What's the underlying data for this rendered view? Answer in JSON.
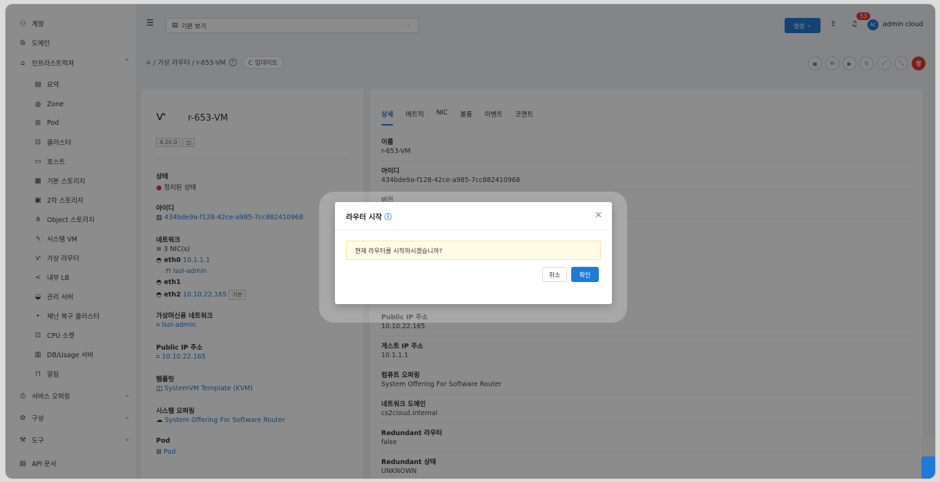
{
  "sidebar": {
    "items": [
      {
        "icon": "user-group-icon",
        "glyph": "⚇",
        "label": "계정"
      },
      {
        "icon": "domain-icon",
        "glyph": "⧉",
        "label": "도메인"
      },
      {
        "icon": "infra-icon",
        "glyph": "⌂",
        "label": "인프라스트럭쳐",
        "chev": "^"
      },
      {
        "icon": "summary-icon",
        "glyph": "▤",
        "label": "요약"
      },
      {
        "icon": "globe-icon",
        "glyph": "◍",
        "label": "Zone"
      },
      {
        "icon": "pod-icon",
        "glyph": "⊞",
        "label": "Pod"
      },
      {
        "icon": "cluster-icon",
        "glyph": "⊟",
        "label": "클러스터"
      },
      {
        "icon": "host-icon",
        "glyph": "▭",
        "label": "호스트"
      },
      {
        "icon": "storage-icon",
        "glyph": "▦",
        "label": "기본 스토리지"
      },
      {
        "icon": "image-storage-icon",
        "glyph": "▣",
        "label": "2차 스토리지"
      },
      {
        "icon": "object-storage-icon",
        "glyph": "⋔",
        "label": "Object 스토리지"
      },
      {
        "icon": "system-vm-icon",
        "glyph": "ϟ",
        "label": "시스템 VM"
      },
      {
        "icon": "router-icon",
        "glyph": "ⱱ",
        "label": "가상 라우터"
      },
      {
        "icon": "lb-icon",
        "glyph": "<",
        "label": "내부 LB"
      },
      {
        "icon": "server-icon",
        "glyph": "◒",
        "label": "관리 서버"
      },
      {
        "icon": "dr-icon",
        "glyph": "•",
        "label": "재난 복구 클러스터"
      },
      {
        "icon": "cpu-icon",
        "glyph": "⊡",
        "label": "CPU 소켓"
      },
      {
        "icon": "chart-icon",
        "glyph": "▥",
        "label": "DB/Usage 서버"
      },
      {
        "icon": "alarm-icon",
        "glyph": "⊓",
        "label": "알림"
      },
      {
        "icon": "service-icon",
        "glyph": "⎙",
        "label": "서비스 오퍼링",
        "chev": "v"
      },
      {
        "icon": "settings-icon",
        "glyph": "⚙",
        "label": "구성",
        "chev": "v"
      },
      {
        "icon": "tool-icon",
        "glyph": "⚒",
        "label": "도구",
        "chev": "v"
      },
      {
        "icon": "doc-icon",
        "glyph": "▤",
        "label": "API 문서"
      }
    ]
  },
  "header": {
    "menu_glyph": "☰",
    "view_select": "기본 보기",
    "view_glyph": "▤",
    "create_label": "생성",
    "notification_count": "53",
    "avatar_initials": "AC",
    "user_name": "admin cloud"
  },
  "breadcrumb": {
    "home_glyph": "⌂",
    "path": "/ 가상 라우터 / r-653-VM",
    "help_glyph": "?",
    "update_label": "C 업데이트"
  },
  "left": {
    "name": "r-653-VM",
    "version_tag": "4.20.0",
    "state_label": "상태",
    "state_value": "정지된 상태",
    "id_label": "아이디",
    "id_value": "434bde9a-f128-42ce-a985-7cc882410968",
    "network_label": "네트워크",
    "nic_count": "3 NIC(s)",
    "eth0": "eth0",
    "eth0_ip": "10.1.1.1",
    "eth0_net": "lsol-admin",
    "eth1": "eth1",
    "eth2": "eth2",
    "eth2_ip": "10.10.22.165",
    "eth2_tag": "기본",
    "guest_net_label": "가상머신용 네트워크",
    "guest_net_value": "lsol-admin",
    "public_ip_label": "Public IP 주소",
    "public_ip_value": "10.10.22.165",
    "template_label": "템플릿",
    "template_value": "SystemVM Template (KVM)",
    "offering_label": "시스템 오퍼링",
    "offering_value": "System Offering For Software Router",
    "pod_label": "Pod",
    "pod_value": "Pod"
  },
  "right": {
    "tabs": [
      "상세",
      "메트릭",
      "NIC",
      "볼륨",
      "이벤트",
      "코멘트"
    ],
    "rows": [
      {
        "k": "이름",
        "v": "r-653-VM"
      },
      {
        "k": "아이디",
        "v": "434bde9a-f128-42ce-a985-7cc882410968"
      },
      {
        "k": "버전",
        "v": ""
      }
    ],
    "rows_low": [
      {
        "k": "Public IP 주소",
        "v": "10.10.22.165"
      },
      {
        "k": "게스트 IP 주소",
        "v": "10.1.1.1"
      },
      {
        "k": "컴퓨트 오퍼링",
        "v": "System Offering For Software Router"
      },
      {
        "k": "네트워크 도메인",
        "v": "cs2cloud.internal"
      },
      {
        "k": "Redundant 라우터",
        "v": "false"
      },
      {
        "k": "Redundant 상태",
        "v": "UNKNOWN"
      }
    ]
  },
  "modal": {
    "title": "라우터 시작",
    "message": "현재 라우터를 시작하시겠습니까?",
    "cancel_label": "취소",
    "ok_label": "확인"
  },
  "colors": {
    "primary": "#1f7ad8",
    "danger": "#e53935"
  }
}
